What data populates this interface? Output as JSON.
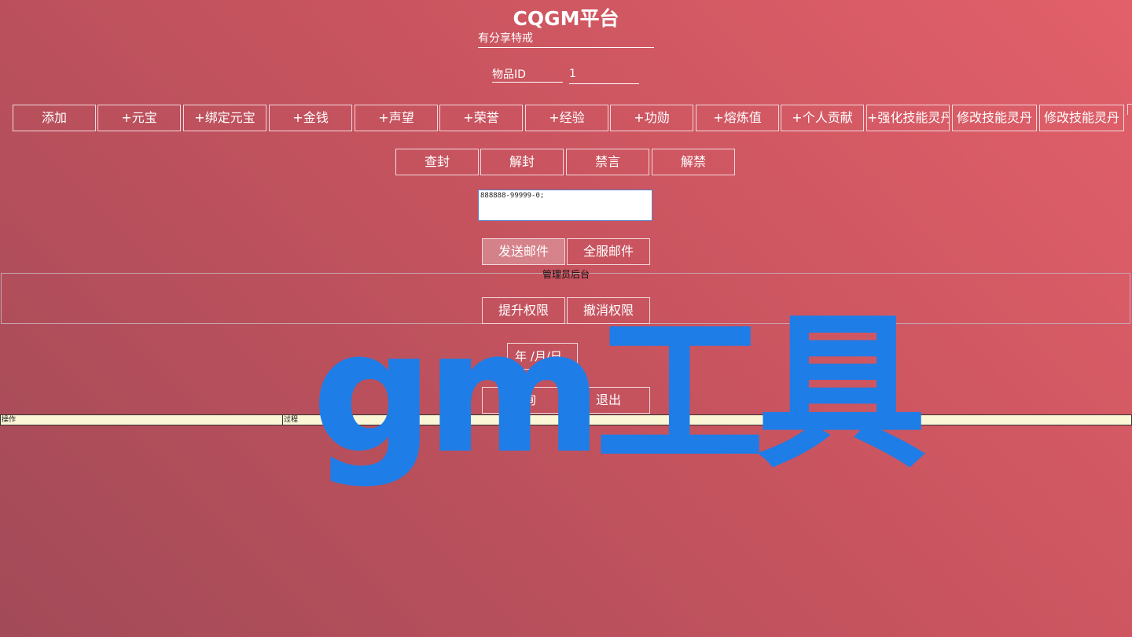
{
  "header": {
    "title": "CQGM平台"
  },
  "reason_input": {
    "value": "有分享特戒"
  },
  "item": {
    "label": "物品ID",
    "value": "1"
  },
  "action_buttons": [
    "添加",
    "+元宝",
    "+绑定元宝",
    "+金钱",
    "+声望",
    "+荣誉",
    "+经验",
    "+功勋",
    "+熔炼值",
    "+个人贡献",
    "+强化技能灵丹",
    "修改技能灵丹",
    "修改技能灵丹"
  ],
  "ban_buttons": [
    "查封",
    "解封",
    "禁言",
    "解禁"
  ],
  "mail": {
    "text": "888888-99999-0;",
    "send_label": "发送邮件",
    "all_label": "全服邮件"
  },
  "admin": {
    "label": "管理员后台",
    "promote_label": "提升权限",
    "revoke_label": "撤消权限"
  },
  "date": {
    "placeholder": "年 /月/日"
  },
  "query": {
    "query_label": "查询",
    "exit_label": "退出"
  },
  "log_table": {
    "headers": [
      "操作",
      "过程",
      "数",
      "日期"
    ]
  },
  "watermark": {
    "text": "gm工具"
  },
  "colors": {
    "background_start": "#e2606a",
    "background_end": "#a24a58",
    "watermark": "#1f7de7",
    "table_header_bg": "#fbf6d6"
  }
}
